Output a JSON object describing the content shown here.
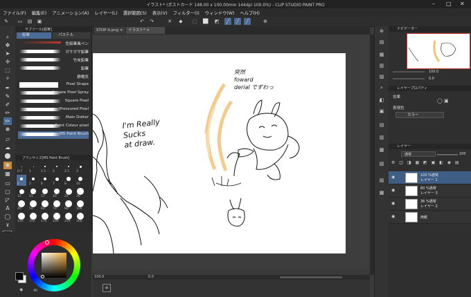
{
  "window": {
    "title": "イラスト* (ポストカード 148.00 x 100.00mm 144dpi 100.0%) - CLIP STUDIO PAINT PRO"
  },
  "menu": [
    "ファイル(F)",
    "編集(E)",
    "アニメーション(A)",
    "レイヤー(L)",
    "選択範囲(S)",
    "表示(V)",
    "フィルター(I)",
    "ウィンドウ(W)",
    "ヘルプ(H)"
  ],
  "tabs": [
    {
      "label": "STOP it.png"
    },
    {
      "label": "イラスト*"
    }
  ],
  "subtool": {
    "tabs": [
      "鉛筆",
      "パステル"
    ],
    "group_label": "サブツール[鉛筆]",
    "brushes": [
      "色鉛筆風ペン",
      "ガサガサ鉛筆",
      "竹炭鉛筆",
      "鉛筆",
      "静電気",
      "Pixel Shape",
      "Square Pixel Spray",
      "Square Pixel",
      "Pressured Pixel",
      "Main Dotter",
      "Paint Colour pixel",
      "MS Paint Brush"
    ]
  },
  "brushsize": {
    "title": "ブラシサイズ[MS Paint Brush]",
    "sizes": [
      "0.7",
      "1",
      "1.5",
      "2",
      "2.5",
      "3",
      "4",
      "5",
      "6",
      "7",
      "8",
      "10",
      "12",
      "15",
      "17",
      "20",
      "25",
      "30",
      "40",
      "50",
      "60",
      "70",
      "80",
      "100",
      "120",
      "150",
      "170",
      "200",
      "250",
      "300"
    ],
    "selected": "4"
  },
  "color": {
    "fg": "#0a0a0a",
    "bg": "#ffffff",
    "hue_hex": "#f5b13a",
    "readout": "40"
  },
  "navigator": {
    "title": "ナビゲーター",
    "zoom": "100.0",
    "angle": "0.0"
  },
  "layer_props": {
    "title": "レイヤープロパティ",
    "effect_label": "効果",
    "express_label": "表現色",
    "express_value": "カラー"
  },
  "layers": {
    "title": "レイヤー",
    "blend": "通常",
    "opacity": "100",
    "items": [
      {
        "line1": "100 %通常",
        "line2": "レイヤー 1",
        "selected": true
      },
      {
        "line1": "60 %通常",
        "line2": "レイヤー 3",
        "selected": false
      },
      {
        "line1": "36 %通常",
        "line2": "レイヤー 2",
        "selected": false
      },
      {
        "line1": "",
        "line2": "用紙",
        "selected": false
      }
    ]
  },
  "canvas_text": {
    "left": "I'm Really\nSucks\nat draw.",
    "top_right": "突然\nfoward\nderial でずわっ"
  },
  "status": {
    "zoom": "100.0",
    "rotation": "0.0"
  }
}
